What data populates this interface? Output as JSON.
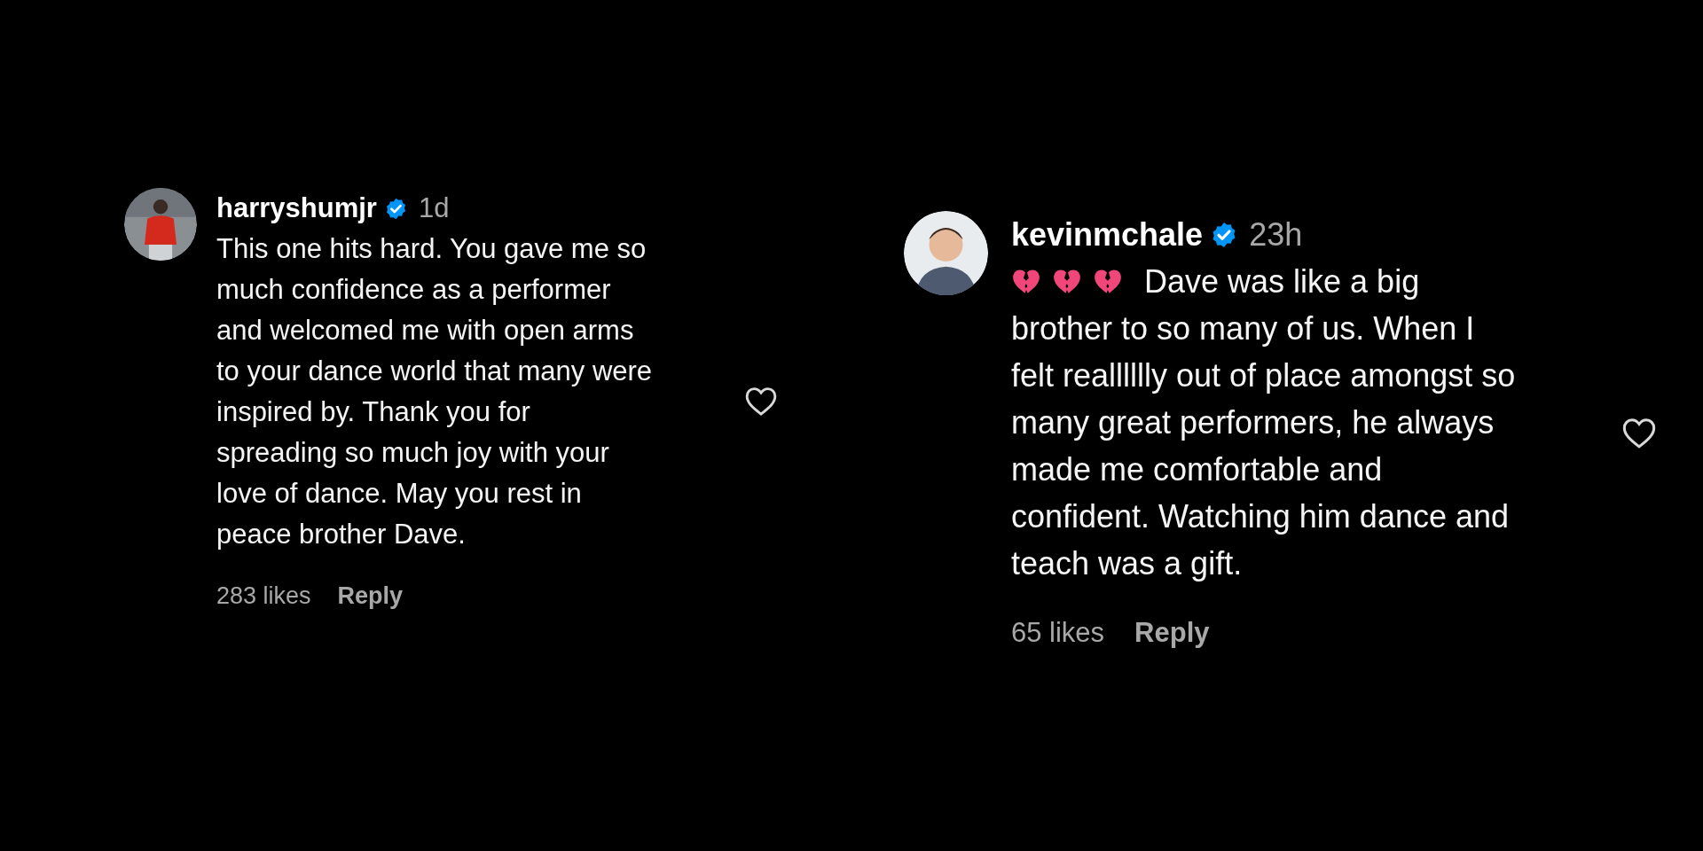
{
  "comments": [
    {
      "username": "harryshumjr",
      "verified": true,
      "time": "1d",
      "avatar": {
        "kind": "picture"
      },
      "lines": [
        "This one hits hard. You gave me so",
        "much confidence as a performer",
        "and welcomed me with open arms",
        "to your dance world that many were",
        "inspired by. Thank you for",
        "spreading so much joy with your",
        "love of dance. May you rest in",
        "peace brother Dave."
      ],
      "likes": "283 likes",
      "reply": "Reply",
      "liked": false
    },
    {
      "username": "kevinmchale",
      "verified": true,
      "time": "23h",
      "avatar": {
        "kind": "picture"
      },
      "icons": [
        {
          "kind": "broken-heart"
        },
        {
          "kind": "broken-heart"
        },
        {
          "kind": "broken-heart"
        }
      ],
      "lines": [
        "Dave was like a big",
        "brother to so many of us. When I",
        "felt realllllly out of place amongst so",
        "many great performers, he always",
        "made me comfortable and",
        "confident. Watching him dance and",
        "teach was a gift."
      ],
      "likes": "65 likes",
      "reply": "Reply",
      "liked": false
    }
  ]
}
